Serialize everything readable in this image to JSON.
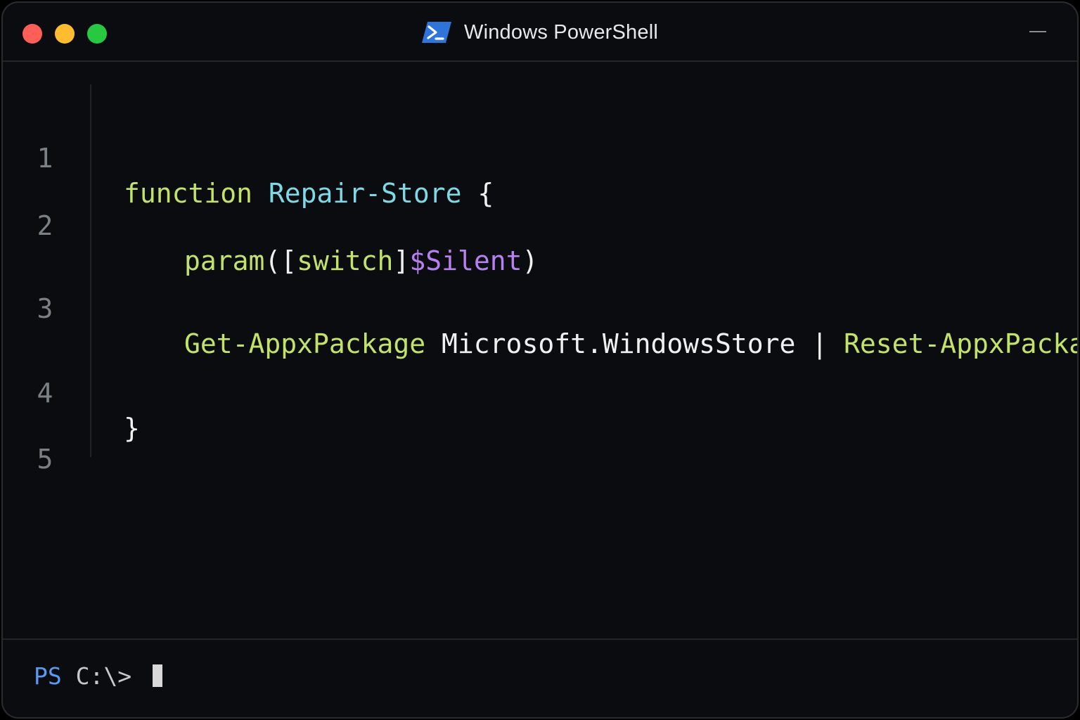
{
  "window": {
    "title": "Windows PowerShell",
    "icon": "powershell-icon",
    "controls": [
      "close",
      "minimize",
      "zoom",
      "collapse"
    ]
  },
  "editor": {
    "lines": [
      {
        "number": "1",
        "tokens": [
          {
            "text": "function",
            "kind": "keyword"
          },
          {
            "text": " ",
            "kind": "plain"
          },
          {
            "text": "Repair-Store",
            "kind": "function-name"
          },
          {
            "text": " {",
            "kind": "plain"
          }
        ]
      },
      {
        "number": "2",
        "tokens": [
          {
            "text": "param",
            "kind": "keyword"
          },
          {
            "text": "([",
            "kind": "plain"
          },
          {
            "text": "switch",
            "kind": "type"
          },
          {
            "text": "]",
            "kind": "plain"
          },
          {
            "text": "$Silent",
            "kind": "variable"
          },
          {
            "text": ")",
            "kind": "plain"
          }
        ]
      },
      {
        "number": "3",
        "tokens": [
          {
            "text": "Get-AppxPackage",
            "kind": "cmdlet"
          },
          {
            "text": " Microsoft.WindowsStore | ",
            "kind": "plain"
          },
          {
            "text": "Reset-AppxPackage",
            "kind": "cmdlet"
          }
        ]
      },
      {
        "number": "4",
        "tokens": [
          {
            "text": "}",
            "kind": "plain"
          }
        ]
      },
      {
        "number": "5",
        "tokens": []
      }
    ]
  },
  "prompt": {
    "tag": "PS",
    "path": " C:\\> "
  },
  "colors": {
    "background": "#0a0c10",
    "keyword": "#c3e26a",
    "function_name": "#7fd8e6",
    "variable": "#b87ff0",
    "plain": "#f0f0f0",
    "line_number": "#7b7f86",
    "prompt_tag": "#5a9af0",
    "close": "#ff5f57",
    "minimize": "#febc2e",
    "zoom": "#28c840"
  }
}
